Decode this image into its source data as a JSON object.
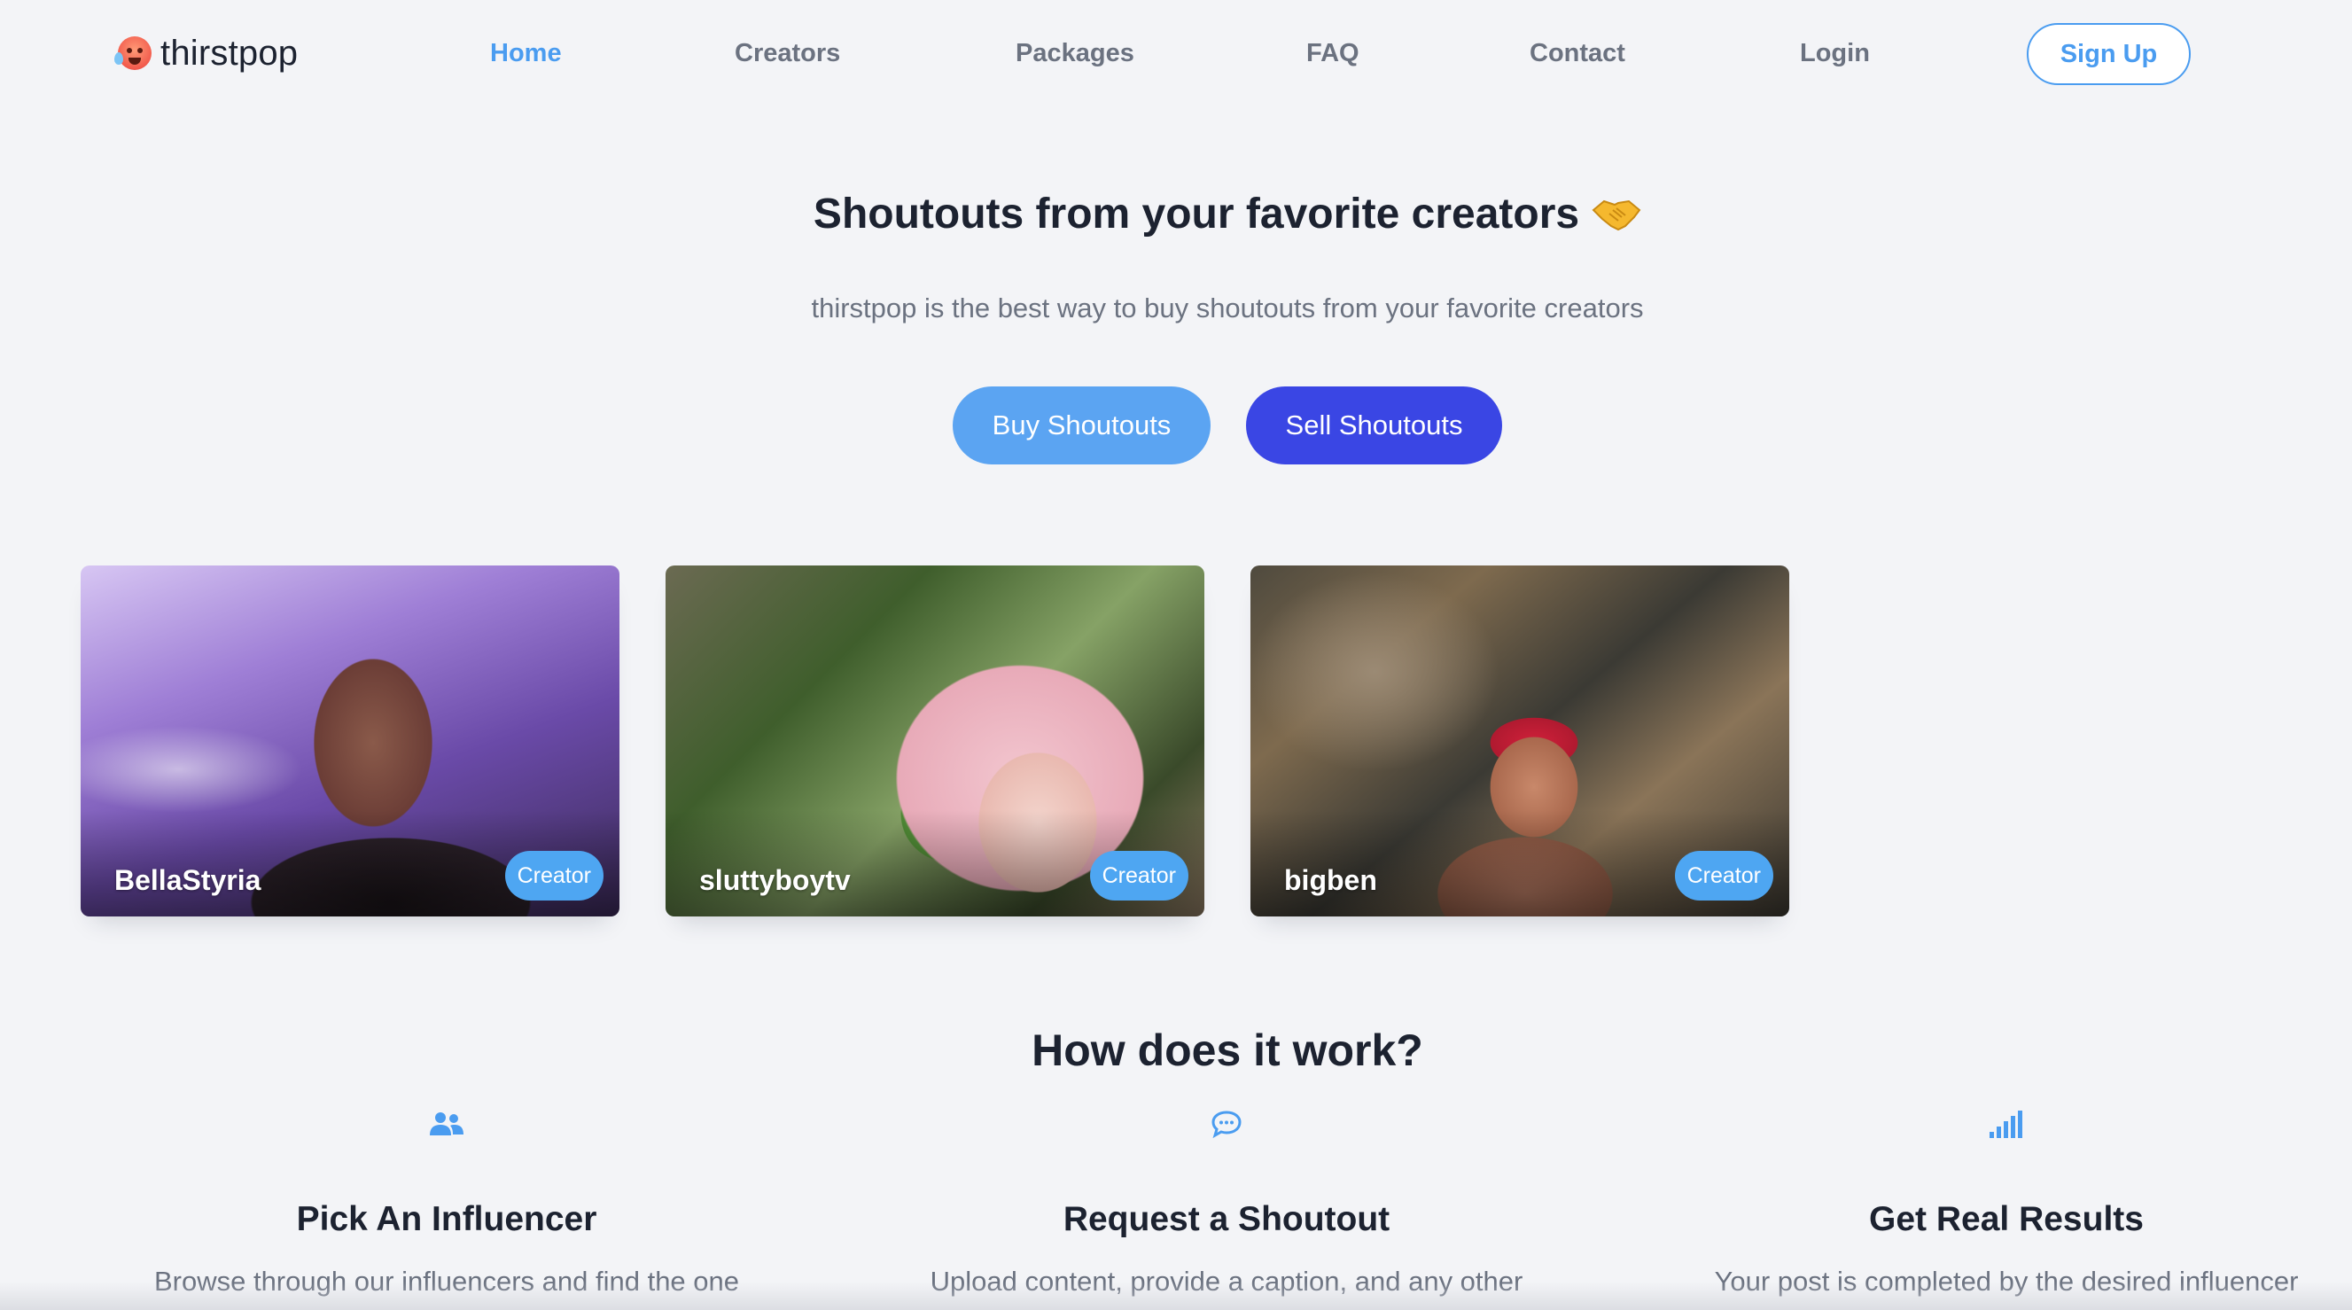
{
  "brand": {
    "name": "thirstpop",
    "logo_icon": "hot-face-emoji"
  },
  "nav": {
    "links": [
      {
        "label": "Home",
        "active": true
      },
      {
        "label": "Creators",
        "active": false
      },
      {
        "label": "Packages",
        "active": false
      },
      {
        "label": "FAQ",
        "active": false
      },
      {
        "label": "Contact",
        "active": false
      },
      {
        "label": "Login",
        "active": false
      }
    ],
    "signup_label": "Sign Up"
  },
  "hero": {
    "title": "Shoutouts from your favorite creators",
    "title_icon": "handshake-emoji",
    "subtitle": "thirstpop is the best way to buy shoutouts from your favorite creators",
    "buy_label": "Buy Shoutouts",
    "sell_label": "Sell Shoutouts"
  },
  "creators": [
    {
      "name": "BellaStyria",
      "badge": "Creator"
    },
    {
      "name": "sluttyboytv",
      "badge": "Creator"
    },
    {
      "name": "bigben",
      "badge": "Creator"
    }
  ],
  "how": {
    "title": "How does it work?",
    "steps": [
      {
        "icon": "users-icon",
        "title": "Pick An Influencer",
        "text": "Browse through our influencers and find the one that best fits your brand and budget."
      },
      {
        "icon": "chat-bubble-icon",
        "title": "Request a Shoutout",
        "text": "Upload content, provide a caption, and any other details for your desired shoutout."
      },
      {
        "icon": "signal-bars-icon",
        "title": "Get Real Results",
        "text": "Your post is completed by the desired influencer delivering real results to your brand."
      }
    ]
  },
  "colors": {
    "accent": "#4a9cf0",
    "buy_button": "#5ba4f2",
    "sell_button": "#3a46e4",
    "badge": "#4ea6f2",
    "background": "#f3f4f7"
  }
}
